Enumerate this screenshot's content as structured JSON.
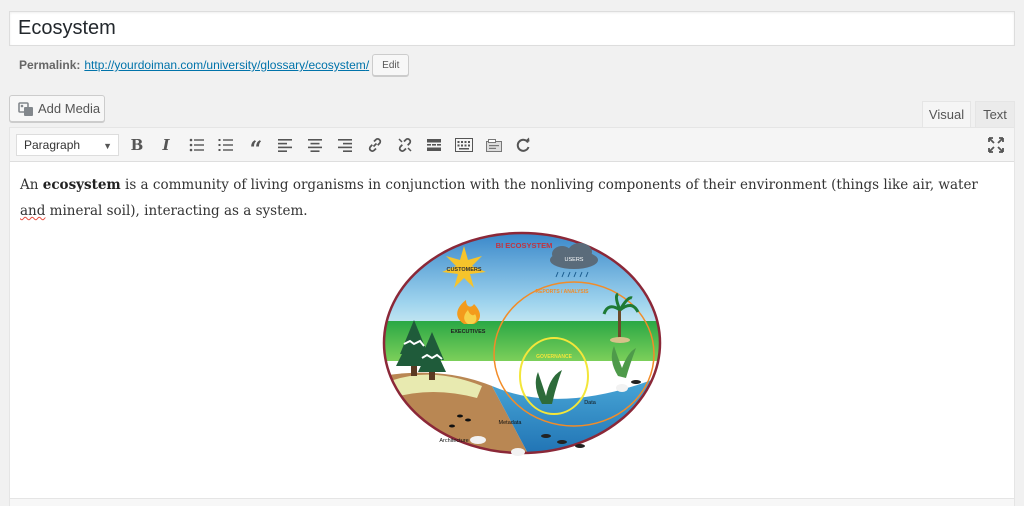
{
  "post": {
    "title": "Ecosystem",
    "permalink_label": "Permalink:",
    "permalink_base": "http://yourdoiman.com/university/glossary/",
    "permalink_slug": "ecosystem",
    "permalink_end": "/",
    "edit_button": "Edit"
  },
  "media": {
    "add_media_label": "Add Media"
  },
  "tabs": {
    "visual": "Visual",
    "text": "Text"
  },
  "toolbar": {
    "format_value": "Paragraph",
    "bold": "B",
    "italic": "I",
    "blockquote": "“"
  },
  "content": {
    "intro_before": "An ",
    "intro_bold": "ecosystem",
    "intro_after": " is a community of living organisms in conjunction with the nonliving components of their environment (things like air, water ",
    "intro_spell": "and",
    "intro_end": " mineral soil), interacting as a system."
  },
  "diagram": {
    "title": "BI ECOSYSTEM",
    "customers": "CUSTOMERS",
    "users": "USERS",
    "reports": "REPORTS / ANALYSIS",
    "executives": "EXECUTIVES",
    "governance": "GOVERNANCE",
    "data": "Data",
    "metadata": "Metadata",
    "architecture": "Architecture"
  }
}
